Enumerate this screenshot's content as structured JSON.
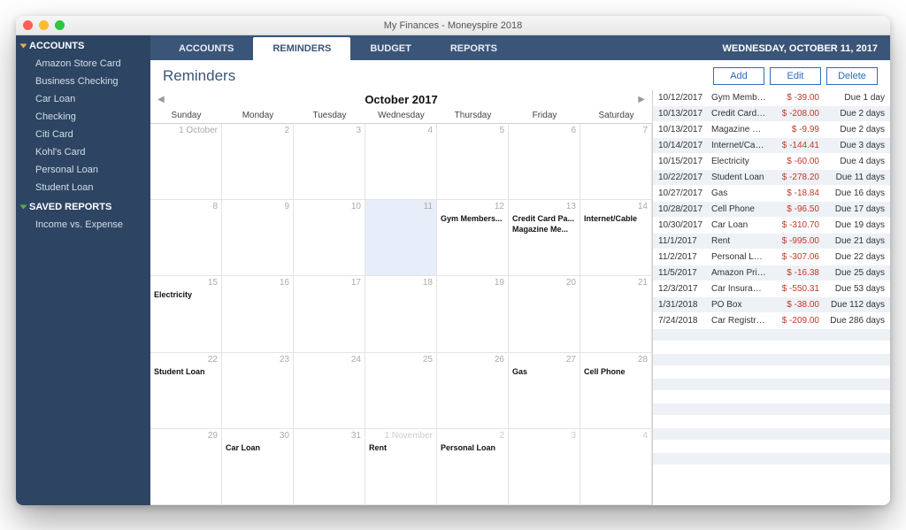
{
  "window_title": "My Finances - Moneyspire 2018",
  "sidebar": {
    "sections": [
      {
        "label": "ACCOUNTS",
        "items": [
          "Amazon Store Card",
          "Business Checking",
          "Car Loan",
          "Checking",
          "Citi Card",
          "Kohl's Card",
          "Personal Loan",
          "Student Loan"
        ]
      },
      {
        "label": "SAVED REPORTS",
        "items": [
          "Income vs. Expense"
        ]
      }
    ]
  },
  "tabs": {
    "items": [
      "ACCOUNTS",
      "REMINDERS",
      "BUDGET",
      "REPORTS"
    ],
    "active": "REMINDERS",
    "date": "WEDNESDAY, OCTOBER 11, 2017"
  },
  "page_title": "Reminders",
  "buttons": {
    "add": "Add",
    "edit": "Edit",
    "delete": "Delete"
  },
  "calendar": {
    "title": "October 2017",
    "days": [
      "Sunday",
      "Monday",
      "Tuesday",
      "Wednesday",
      "Thursday",
      "Friday",
      "Saturday"
    ],
    "cells": [
      {
        "n": "1 October",
        "e": []
      },
      {
        "n": "2",
        "e": []
      },
      {
        "n": "3",
        "e": []
      },
      {
        "n": "4",
        "e": []
      },
      {
        "n": "5",
        "e": []
      },
      {
        "n": "6",
        "e": []
      },
      {
        "n": "7",
        "e": []
      },
      {
        "n": "8",
        "e": []
      },
      {
        "n": "9",
        "e": []
      },
      {
        "n": "10",
        "e": []
      },
      {
        "n": "11",
        "e": [],
        "today": true
      },
      {
        "n": "12",
        "e": [
          "Gym Members..."
        ]
      },
      {
        "n": "13",
        "e": [
          "Credit Card Pa...",
          "Magazine Me..."
        ]
      },
      {
        "n": "14",
        "e": [
          "Internet/Cable"
        ]
      },
      {
        "n": "15",
        "e": [
          "Electricity"
        ]
      },
      {
        "n": "16",
        "e": []
      },
      {
        "n": "17",
        "e": []
      },
      {
        "n": "18",
        "e": []
      },
      {
        "n": "19",
        "e": []
      },
      {
        "n": "20",
        "e": []
      },
      {
        "n": "21",
        "e": []
      },
      {
        "n": "22",
        "e": [
          "Student Loan"
        ]
      },
      {
        "n": "23",
        "e": []
      },
      {
        "n": "24",
        "e": []
      },
      {
        "n": "25",
        "e": []
      },
      {
        "n": "26",
        "e": []
      },
      {
        "n": "27",
        "e": [
          "Gas"
        ]
      },
      {
        "n": "28",
        "e": [
          "Cell Phone"
        ]
      },
      {
        "n": "29",
        "e": []
      },
      {
        "n": "30",
        "e": [
          "Car Loan"
        ]
      },
      {
        "n": "31",
        "e": []
      },
      {
        "n": "1 November",
        "e": [
          "Rent"
        ],
        "other": true
      },
      {
        "n": "2",
        "e": [
          "Personal Loan"
        ],
        "other": true
      },
      {
        "n": "3",
        "e": [],
        "other": true
      },
      {
        "n": "4",
        "e": [],
        "other": true
      }
    ]
  },
  "reminders": [
    {
      "date": "10/12/2017",
      "name": "Gym Membership",
      "amt": "$ -39.00",
      "due": "Due 1 day"
    },
    {
      "date": "10/13/2017",
      "name": "Credit Card Payment",
      "amt": "$ -208.00",
      "due": "Due 2 days"
    },
    {
      "date": "10/13/2017",
      "name": "Magazine Membership",
      "amt": "$ -9.99",
      "due": "Due 2 days"
    },
    {
      "date": "10/14/2017",
      "name": "Internet/Cable",
      "amt": "$ -144.41",
      "due": "Due 3 days"
    },
    {
      "date": "10/15/2017",
      "name": "Electricity",
      "amt": "$ -60.00",
      "due": "Due 4 days"
    },
    {
      "date": "10/22/2017",
      "name": "Student Loan",
      "amt": "$ -278.20",
      "due": "Due 11 days"
    },
    {
      "date": "10/27/2017",
      "name": "Gas",
      "amt": "$ -18.84",
      "due": "Due 16 days"
    },
    {
      "date": "10/28/2017",
      "name": "Cell Phone",
      "amt": "$ -96.50",
      "due": "Due 17 days"
    },
    {
      "date": "10/30/2017",
      "name": "Car Loan",
      "amt": "$ -310.70",
      "due": "Due 19 days"
    },
    {
      "date": "11/1/2017",
      "name": "Rent",
      "amt": "$ -995.00",
      "due": "Due 21 days"
    },
    {
      "date": "11/2/2017",
      "name": "Personal Loan",
      "amt": "$ -307.06",
      "due": "Due 22 days"
    },
    {
      "date": "11/5/2017",
      "name": "Amazon Prime",
      "amt": "$ -16.38",
      "due": "Due 25 days"
    },
    {
      "date": "12/3/2017",
      "name": "Car Insurance",
      "amt": "$ -550.31",
      "due": "Due 53 days"
    },
    {
      "date": "1/31/2018",
      "name": "PO Box",
      "amt": "$ -38.00",
      "due": "Due 112 days"
    },
    {
      "date": "7/24/2018",
      "name": "Car Registration",
      "amt": "$ -209.00",
      "due": "Due 286 days"
    }
  ]
}
